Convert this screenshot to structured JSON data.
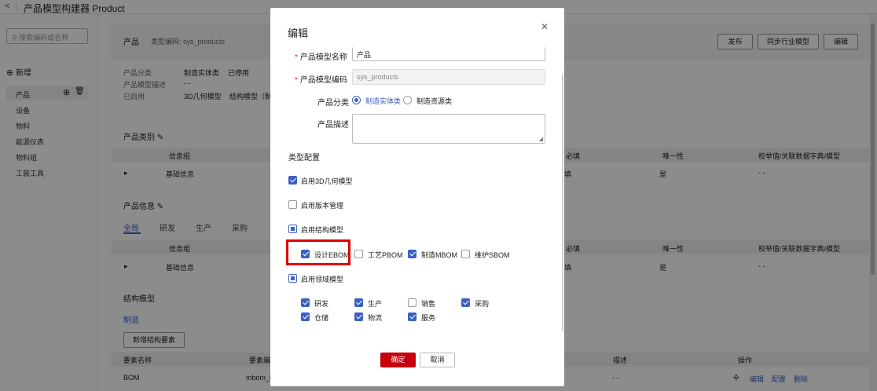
{
  "app": {
    "title": "产品模型构建器 Product"
  },
  "sidebar": {
    "search_placeholder": "搜索编码或名称",
    "add_label": "新增",
    "items": [
      "产品",
      "设备",
      "物料",
      "能源仪表",
      "物料组",
      "工装工具"
    ]
  },
  "header": {
    "name": "产品",
    "code_label": "类型编码: sys_products",
    "buttons": [
      "发布",
      "同步行业模型",
      "编辑"
    ]
  },
  "info": {
    "labels": [
      "产品分类",
      "产品模型描述",
      "已启用"
    ],
    "values": [
      "制造实体类",
      "已停用",
      "- -",
      "3D几何模型",
      "结构模型（制造"
    ]
  },
  "category_section": {
    "title": "产品类别",
    "columns": [
      "信息组",
      "必填",
      "唯一性",
      "校举值/关联数据字典/模型"
    ],
    "row": {
      "group": "基础信息",
      "required_tail": "填",
      "unique": "是",
      "enum": "- -"
    }
  },
  "info_section": {
    "title": "产品信息",
    "tabs": [
      "全局",
      "研发",
      "生产",
      "采购"
    ],
    "columns": [
      "信息组",
      "必填",
      "唯一性",
      "校举值/关联数据字典/模型"
    ],
    "row": {
      "group": "基础信息",
      "required_tail": "填",
      "unique": "是",
      "enum": "- -"
    }
  },
  "structure_section": {
    "title": "结构模型",
    "tab": "制造",
    "add_button": "新增结构要素",
    "columns": [
      "要素名称",
      "要素编",
      "描述",
      "操作"
    ],
    "row": {
      "name": "BOM",
      "code": "mbom_b",
      "desc": "- -",
      "actions": [
        "编辑",
        "配置",
        "删除"
      ]
    }
  },
  "modal": {
    "title": "编辑",
    "fields": {
      "name_label": "产品模型名称",
      "name_value": "产品",
      "code_label": "产品模型编码",
      "code_value": "sys_products",
      "category_label": "产品分类",
      "category_options": [
        "制造实体类",
        "制造资源类"
      ],
      "desc_label": "产品描述"
    },
    "type_config_label": "类型配置",
    "enable_3d": "启用3D几何模型",
    "enable_version": "启用版本管理",
    "enable_structure": "启用结构模型",
    "structure_options": [
      "设计EBOM",
      "工艺PBOM",
      "制造MBOM",
      "维护SBOM"
    ],
    "enable_domain": "启用领域模型",
    "domain_options": [
      "研发",
      "生产",
      "销售",
      "采购",
      "仓储",
      "物流",
      "服务"
    ],
    "ok": "确定",
    "cancel": "取消"
  },
  "colors": {
    "accent": "#3b61c4",
    "primary_button": "#c7000b",
    "highlight": "#e00000"
  }
}
